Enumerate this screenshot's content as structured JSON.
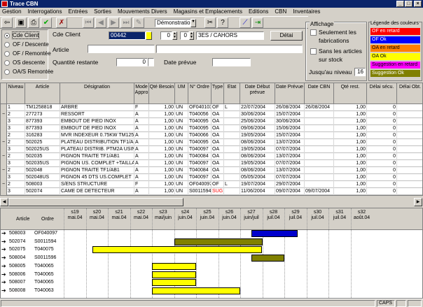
{
  "window": {
    "title": "Trace CBN"
  },
  "menu": [
    "Gestion",
    "Interrogations",
    "Entrées",
    "Sorties",
    "Mouvements Divers",
    "Magasins et Emplacements",
    "Editions",
    "CBN",
    "Inventaires"
  ],
  "toolbar": {
    "combo_value": "Démonstration 3"
  },
  "mode_radios": [
    {
      "label": "Cde Client",
      "selected": true
    },
    {
      "label": "OF / Descente",
      "selected": false
    },
    {
      "label": "OF / Remontée",
      "selected": false
    },
    {
      "label": "OS descente",
      "selected": false
    },
    {
      "label": "OA/S Remontée",
      "selected": false
    }
  ],
  "form": {
    "cde_client_label": "Cde Client",
    "cde_client_value": "00442",
    "spin1": "0",
    "spin2": "0",
    "client_name": "3ES / CAHORS",
    "detail_button": "Détai",
    "article_label": "Article",
    "qty_label": "Quantité restante",
    "qty_value": "0",
    "date_label": "Date prévue"
  },
  "affichage": {
    "title": "Affichage",
    "opt1": "Seulement les fabrications",
    "opt2": "Sans les articles sur stock",
    "level_label": "Jusqu'au niveau",
    "level_value": "16"
  },
  "legend": {
    "title": "Légende des couleurs",
    "items": [
      {
        "label": "OF en retard",
        "color": "#ff0000",
        "text": "#ffffff"
      },
      {
        "label": "OF Ok",
        "color": "#0000ff",
        "text": "#ffffff"
      },
      {
        "label": "OA en retard",
        "color": "#ff8000",
        "text": "#000000"
      },
      {
        "label": "OA Ok",
        "color": "#ffff00",
        "text": "#000000"
      },
      {
        "label": "Suggestion en retard",
        "color": "#ff00ff",
        "text": "#000000"
      },
      {
        "label": "Suggestion Ok",
        "color": "#808000",
        "text": "#ffffff"
      }
    ]
  },
  "grid": {
    "headers": [
      "Niveau",
      "Article",
      "Désignation",
      "Mode Appro",
      "Qté Besoin",
      "UM",
      "N° Ordre",
      "Type",
      "Etat",
      "Date Début prévue",
      "Date Prévue",
      "Date CBN",
      "Qté rest.",
      "Délai sécu.",
      "Délai Obt."
    ],
    "rows": [
      {
        "m": "",
        "niv": "1",
        "art": "TM1258818",
        "des": "ARBRE",
        "mode": "F",
        "qte": "1,00",
        "um": "UN",
        "ord": "OF040103",
        "type": "OF",
        "etat": "L",
        "d1": "22/07/2004",
        "d2": "26/08/2004",
        "d3": "26/08/2004",
        "rest": "1,00",
        "sec": "0"
      },
      {
        "m": "−",
        "niv": "2",
        "art": "277273",
        "des": "RESSORT",
        "mode": "A",
        "qte": "1,00",
        "um": "UN",
        "ord": "T040056",
        "type": "OA",
        "etat": "",
        "d1": "30/06/2004",
        "d2": "15/07/2004",
        "d3": "",
        "rest": "1,00",
        "sec": "0"
      },
      {
        "m": "",
        "niv": "3",
        "art": "877393",
        "des": "EMBOUT DE PIED INOX",
        "mode": "A",
        "qte": "1,00",
        "um": "UN",
        "ord": "T040095",
        "type": "OA",
        "etat": "",
        "d1": "25/06/2004",
        "d2": "30/06/2004",
        "d3": "",
        "rest": "1,00",
        "sec": "0"
      },
      {
        "m": "",
        "niv": "3",
        "art": "877393",
        "des": "EMBOUT DE PIED INOX",
        "mode": "A",
        "qte": "1,00",
        "um": "UN",
        "ord": "T040095",
        "type": "OA",
        "etat": "",
        "d1": "09/06/2004",
        "d2": "15/06/2004",
        "d3": "",
        "rest": "1,00",
        "sec": "0"
      },
      {
        "m": "",
        "niv": "2",
        "art": "316283",
        "des": "MVR  INDEXEUR 0.75KW TM125",
        "mode": "A",
        "qte": "1,00",
        "um": "UN",
        "ord": "T040066",
        "type": "OA",
        "etat": "",
        "d1": "19/05/2004",
        "d2": "15/07/2004",
        "d3": "",
        "rest": "1,00",
        "sec": "0"
      },
      {
        "m": "−",
        "niv": "2",
        "art": "502025",
        "des": "PLATEAU DISTRIBUTION TF1/AB1",
        "mode": "A",
        "qte": "1,00",
        "um": "UN",
        "ord": "T040095",
        "type": "OA",
        "etat": "",
        "d1": "08/06/2004",
        "d2": "13/07/2004",
        "d3": "",
        "rest": "1,00",
        "sec": "0"
      },
      {
        "m": "",
        "niv": "3",
        "art": "502025US",
        "des": "PLATEAU DISTRIB. PTM2A USINE",
        "mode": "A",
        "qte": "1,00",
        "um": "UN",
        "ord": "T040097",
        "type": "OA",
        "etat": "",
        "d1": "19/05/2004",
        "d2": "07/07/2004",
        "d3": "",
        "rest": "1,00",
        "sec": "0"
      },
      {
        "m": "−",
        "niv": "2",
        "art": "502035",
        "des": "PIGNON TRAITE TF1/AB1",
        "mode": "A",
        "qte": "1,00",
        "um": "UN",
        "ord": "T040084",
        "type": "OA",
        "etat": "",
        "d1": "08/06/2004",
        "d2": "13/07/2004",
        "d3": "",
        "rest": "1,00",
        "sec": "0"
      },
      {
        "m": "",
        "niv": "3",
        "art": "502035US",
        "des": "PIGNON US. COMPLET +TAILLAGE",
        "mode": "A",
        "qte": "1,00",
        "um": "UN",
        "ord": "T040097",
        "type": "OA",
        "etat": "",
        "d1": "19/05/2004",
        "d2": "07/07/2004",
        "d3": "",
        "rest": "1,00",
        "sec": "0"
      },
      {
        "m": "−",
        "niv": "2",
        "art": "502048",
        "des": "PIGNON TRAITE TF1/AB1",
        "mode": "A",
        "qte": "1,00",
        "um": "UN",
        "ord": "T040084",
        "type": "OA",
        "etat": "",
        "d1": "08/06/2004",
        "d2": "13/07/2004",
        "d3": "",
        "rest": "1,00",
        "sec": "0"
      },
      {
        "m": "",
        "niv": "3",
        "art": "502048US",
        "des": "PIGNON 45 DTS US.COMPLET",
        "mode": "A",
        "qte": "1,00",
        "um": "UN",
        "ord": "T040097",
        "type": "OA",
        "etat": "",
        "d1": "05/05/2004",
        "d2": "07/07/2004",
        "d3": "",
        "rest": "1,00",
        "sec": "0"
      },
      {
        "m": "−",
        "niv": "2",
        "art": "508003",
        "des": "S/ENS STRUCTURE",
        "mode": "F",
        "qte": "1,00",
        "um": "UN",
        "ord": "OF040097",
        "type": "OF",
        "etat": "L",
        "d1": "19/07/2004",
        "d2": "29/07/2004",
        "d3": "",
        "rest": "1,00",
        "sec": "0"
      },
      {
        "m": "",
        "niv": "3",
        "art": "502074",
        "des": "CAME DE DETECTEUR",
        "mode": "A",
        "qte": "1,00",
        "um": "UN",
        "ord": "S0011594",
        "type": "SUG",
        "etat": "",
        "d1": "11/06/2004",
        "d2": "09/07/2004",
        "d3": "09/07/2004",
        "rest": "1,00",
        "sec": "0"
      }
    ]
  },
  "gantt": {
    "col_article": "Article",
    "col_ordre": "Ordre",
    "weeks": [
      {
        "w": "s19",
        "d": "mai.04"
      },
      {
        "w": "s20",
        "d": "mai.04"
      },
      {
        "w": "s21",
        "d": "mai.04"
      },
      {
        "w": "s22",
        "d": "mai.04"
      },
      {
        "w": "s23",
        "d": "mai/juin"
      },
      {
        "w": "s24",
        "d": "juin.04"
      },
      {
        "w": "s25",
        "d": "juin.04"
      },
      {
        "w": "s26",
        "d": "juin.04"
      },
      {
        "w": "s27",
        "d": "juin/juil"
      },
      {
        "w": "s28",
        "d": "juil.04"
      },
      {
        "w": "s29",
        "d": "juil.04"
      },
      {
        "w": "s30",
        "d": "juil.04"
      },
      {
        "w": "s31",
        "d": "juil.04"
      },
      {
        "w": "s32",
        "d": "août.04"
      }
    ],
    "rows": [
      {
        "art": "508003",
        "ord": "OF040097",
        "bars": [
          {
            "start": 27.5,
            "end": 29.6,
            "color": "#0000cc"
          }
        ]
      },
      {
        "art": "502074",
        "ord": "S0011594",
        "bars": [
          {
            "start": 24,
            "end": 28,
            "color": "#808000"
          }
        ]
      },
      {
        "art": "502075",
        "ord": "T040075",
        "bars": [
          {
            "start": 20.3,
            "end": 28,
            "color": "#ffff00"
          }
        ]
      },
      {
        "art": "508004",
        "ord": "S0011596",
        "bars": [
          {
            "start": 27.5,
            "end": 29,
            "color": "#808000"
          }
        ]
      },
      {
        "art": "508005",
        "ord": "T040065",
        "bars": [
          {
            "start": 23,
            "end": 25,
            "color": "#ffff00"
          }
        ]
      },
      {
        "art": "508006",
        "ord": "T040065",
        "bars": [
          {
            "start": 23,
            "end": 25,
            "color": "#ffff00"
          }
        ]
      },
      {
        "art": "508007",
        "ord": "T040065",
        "bars": [
          {
            "start": 23,
            "end": 25,
            "color": "#ffff00"
          }
        ]
      },
      {
        "art": "508008",
        "ord": "T040063",
        "bars": [
          {
            "start": 23,
            "end": 27,
            "color": "#ffff00"
          }
        ]
      }
    ]
  },
  "status": {
    "caps": "CAPS"
  }
}
